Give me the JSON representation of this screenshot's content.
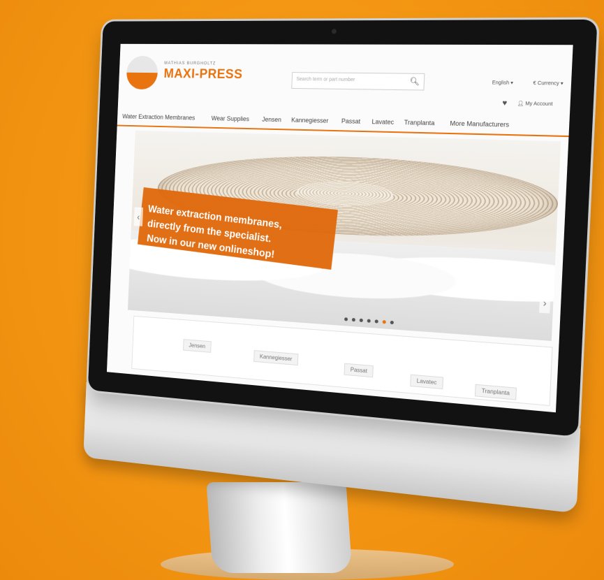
{
  "logo": {
    "tagline": "MATHIAS BURGHOLTZ",
    "name": "MAXI-PRESS"
  },
  "search": {
    "placeholder": "Search term or part number"
  },
  "header": {
    "language": "English ▾",
    "currency": "€ Currency ▾",
    "account": "My Account"
  },
  "nav": {
    "items": [
      "Water Extraction Membranes",
      "Wear Supplies",
      "Jensen",
      "Kannegiesser",
      "Passat",
      "Lavatec",
      "Tranplanta",
      "More Manufacturers"
    ]
  },
  "hero": {
    "lines": [
      "Water extraction membranes,",
      "directly from the specialist.",
      "Now in our new onlineshop!"
    ],
    "active_slide": 5,
    "slide_count": 7
  },
  "brands": [
    "Jensen",
    "Kannegiesser",
    "Passat",
    "Lavatec",
    "Tranplanta"
  ],
  "colors": {
    "accent": "#e8730f",
    "background": "#f39512"
  }
}
